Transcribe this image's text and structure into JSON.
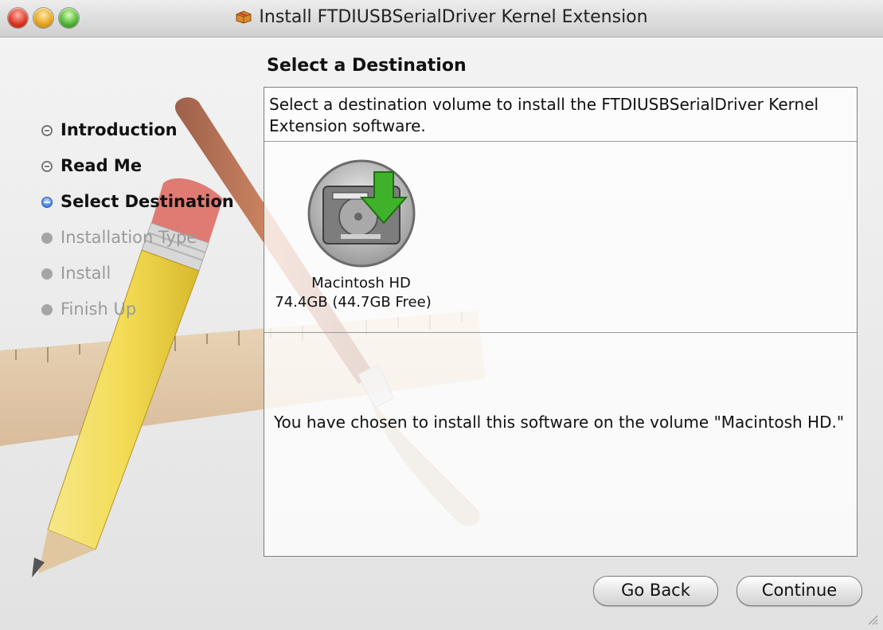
{
  "window": {
    "title": "Install FTDIUSBSerialDriver Kernel Extension",
    "title_icon": "package-icon"
  },
  "page": {
    "heading": "Select a Destination"
  },
  "steps": [
    {
      "label": "Introduction",
      "state": "done"
    },
    {
      "label": "Read Me",
      "state": "done"
    },
    {
      "label": "Select Destination",
      "state": "current"
    },
    {
      "label": "Installation Type",
      "state": "pending"
    },
    {
      "label": "Install",
      "state": "pending"
    },
    {
      "label": "Finish Up",
      "state": "pending"
    }
  ],
  "panel": {
    "instructions": "Select a destination volume to install the FTDIUSBSerialDriver Kernel Extension software.",
    "volume": {
      "name": "Macintosh HD",
      "size": "74.4GB (44.7GB Free)",
      "icon": "hard-drive-install-icon"
    },
    "message": "You have chosen to install this software on the volume \"Macintosh HD.\""
  },
  "buttons": {
    "go_back": "Go Back",
    "continue": "Continue"
  },
  "colors": {
    "accent_blue": "#3a7fe0",
    "arrow_green": "#3fb12b"
  }
}
